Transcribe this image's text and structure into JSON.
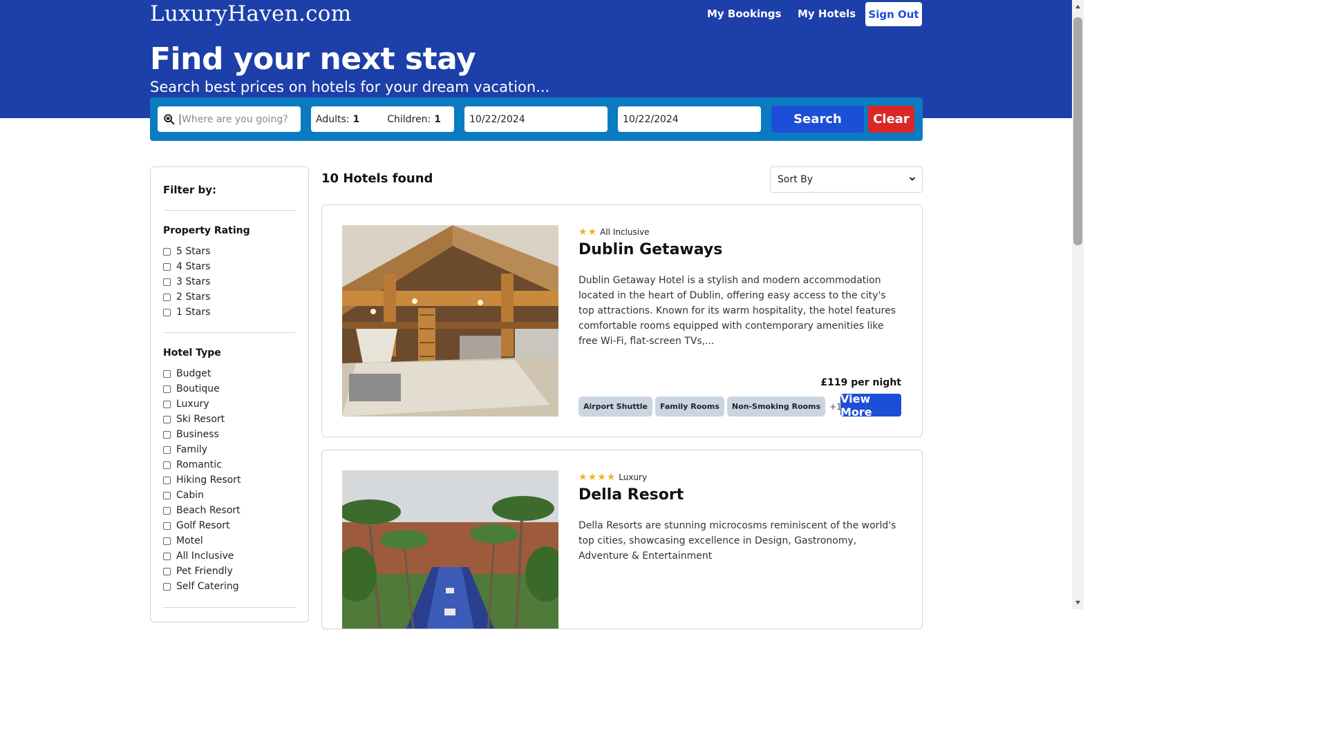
{
  "header": {
    "logo": "LuxuryHaven.com",
    "nav": {
      "bookings": "My Bookings",
      "hotels": "My Hotels",
      "signout": "Sign Out"
    },
    "title": "Find your next stay",
    "subtitle": "Search best prices on hotels for your dream vacation..."
  },
  "search": {
    "destination_placeholder": "Where are you going?",
    "destination_value": "",
    "adults_label": "Adults:",
    "adults_value": "1",
    "children_label": "Children:",
    "children_value": "1",
    "checkin": "10/22/2024",
    "checkout": "10/22/2024",
    "search_label": "Search",
    "clear_label": "Clear"
  },
  "filters": {
    "title": "Filter by:",
    "rating_title": "Property Rating",
    "ratings": [
      "5 Stars",
      "4 Stars",
      "3 Stars",
      "2 Stars",
      "1 Stars"
    ],
    "type_title": "Hotel Type",
    "types": [
      "Budget",
      "Boutique",
      "Luxury",
      "Ski Resort",
      "Business",
      "Family",
      "Romantic",
      "Hiking Resort",
      "Cabin",
      "Beach Resort",
      "Golf Resort",
      "Motel",
      "All Inclusive",
      "Pet Friendly",
      "Self Catering"
    ]
  },
  "results": {
    "count_text": "10 Hotels found",
    "sort_label": "Sort By"
  },
  "hotels": [
    {
      "stars": 2,
      "type": "All Inclusive",
      "name": "Dublin Getaways",
      "description": "Dublin Getaway Hotel is a stylish and modern accommodation located in the heart of Dublin, offering easy access to the city's top attractions. Known for its warm hospitality, the hotel features comfortable rooms equipped with contemporary amenities like free Wi-Fi, flat-screen TVs,...",
      "price": "£119 per night",
      "facilities": [
        "Airport Shuttle",
        "Family Rooms",
        "Non-Smoking Rooms"
      ],
      "more": "+1 more",
      "view_label": "View More"
    },
    {
      "stars": 4,
      "type": "Luxury",
      "name": "Della Resort",
      "description": "Della Resorts are stunning microcosms reminiscent of the world's top cities, showcasing excellence in Design, Gastronomy, Adventure & Entertainment"
    }
  ],
  "colors": {
    "header_bg": "#1d3fa9",
    "searchbar_bg": "#0a7bc1",
    "primary": "#1d4ed8",
    "danger": "#dc2626",
    "star": "#f2b01e"
  }
}
